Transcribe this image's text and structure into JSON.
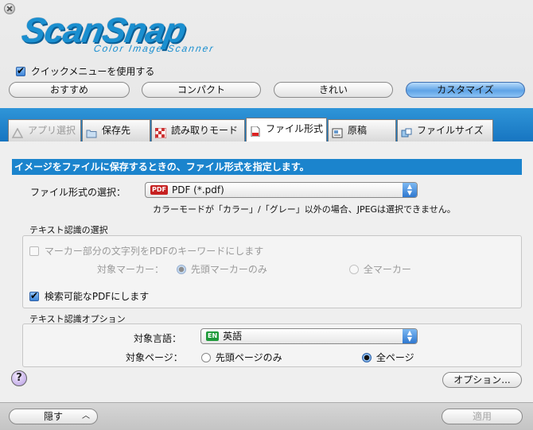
{
  "logo": {
    "main": "ScanSnap",
    "sub": "Color Image Scanner"
  },
  "quick_menu": {
    "label": "クイックメニューを使用する",
    "checked": true
  },
  "presets": [
    {
      "label": "おすすめ",
      "selected": false
    },
    {
      "label": "コンパクト",
      "selected": false
    },
    {
      "label": "きれい",
      "selected": false
    },
    {
      "label": "カスタマイズ",
      "selected": true
    }
  ],
  "tabs": [
    {
      "label": "アプリ選択",
      "icon": "app-icon",
      "disabled": true
    },
    {
      "label": "保存先",
      "icon": "folder-icon"
    },
    {
      "label": "読み取りモード",
      "icon": "checker-icon"
    },
    {
      "label": "ファイル形式",
      "icon": "pdf-file-icon",
      "active": true
    },
    {
      "label": "原稿",
      "icon": "document-icon"
    },
    {
      "label": "ファイルサイズ",
      "icon": "filesize-icon"
    }
  ],
  "heading": "イメージをファイルに保存するときの、ファイル形式を指定します。",
  "file_format": {
    "label": "ファイル形式の選択：",
    "badge": "PDF",
    "value": "PDF (*.pdf)",
    "note": "カラーモードが「カラー」/「グレー」以外の場合、JPEGは選択できません。"
  },
  "text_recognition": {
    "group_label": "テキスト認識の選択",
    "marker_keyword_label": "マーカー部分の文字列をPDFのキーワードにします",
    "marker_keyword_checked": false,
    "target_marker_label": "対象マーカー：",
    "first_marker_label": "先頭マーカーのみ",
    "all_markers_label": "全マーカー",
    "searchable_pdf_label": "検索可能なPDFにします",
    "searchable_pdf_checked": true
  },
  "text_options": {
    "group_label": "テキスト認識オプション",
    "language_label": "対象言語：",
    "language_badge": "EN",
    "language_value": "英語",
    "pages_label": "対象ページ：",
    "first_page_label": "先頭ページのみ",
    "all_pages_label": "全ページ",
    "selected": "all_pages"
  },
  "help_label": "?",
  "options_button": "オプション...",
  "hide_button": "隠す",
  "apply_button": "適用",
  "colors": {
    "accent_blue": "#1b84cd",
    "band_blue": "#1775c1",
    "logo_blue": "#1a8fd0"
  }
}
